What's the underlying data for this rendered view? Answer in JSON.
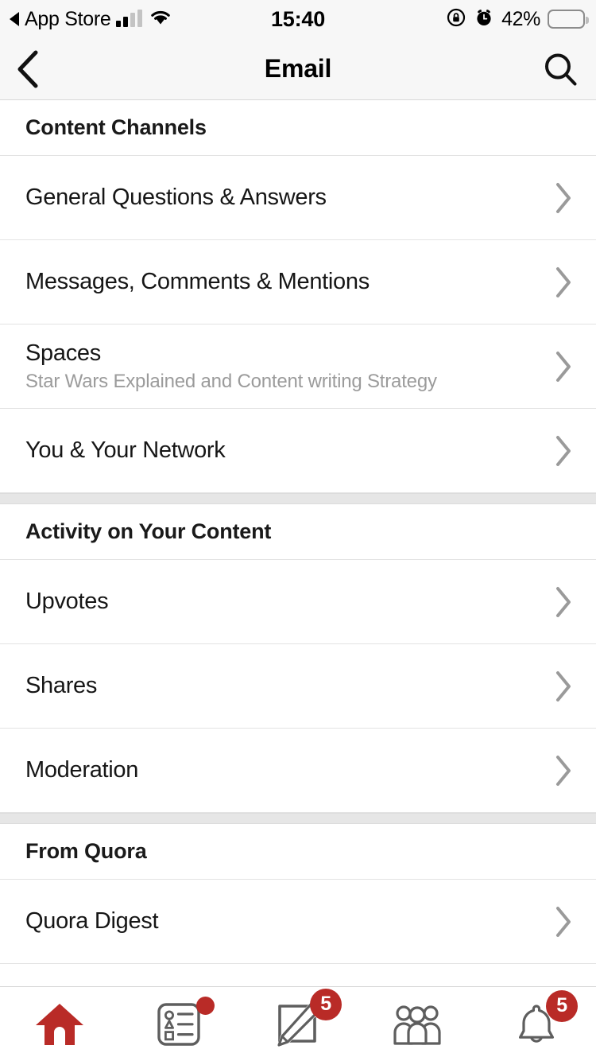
{
  "status_bar": {
    "back_app_label": "App Store",
    "back_arrow_icon": "triangle-left-icon",
    "signal_icon": "cellular-signal-icon",
    "wifi_icon": "wifi-icon",
    "time": "15:40",
    "rotation_lock_icon": "rotation-lock-icon",
    "alarm_icon": "alarm-clock-icon",
    "battery_percent": "42%",
    "battery_icon": "battery-icon",
    "battery_fill_color": "#ffcc00",
    "battery_level": 42
  },
  "nav_bar": {
    "back_icon": "chevron-left-icon",
    "title": "Email",
    "search_icon": "search-icon"
  },
  "sections": [
    {
      "header": "Content Channels",
      "rows": [
        {
          "title": "General Questions & Answers",
          "subtitle": "",
          "chevron_icon": "chevron-right-icon"
        },
        {
          "title": "Messages, Comments & Mentions",
          "subtitle": "",
          "chevron_icon": "chevron-right-icon"
        },
        {
          "title": "Spaces",
          "subtitle": "Star Wars Explained and Content writing Strategy",
          "chevron_icon": "chevron-right-icon"
        },
        {
          "title": "You & Your Network",
          "subtitle": "",
          "chevron_icon": "chevron-right-icon"
        }
      ]
    },
    {
      "header": "Activity on Your Content",
      "rows": [
        {
          "title": "Upvotes",
          "subtitle": "",
          "chevron_icon": "chevron-right-icon"
        },
        {
          "title": "Shares",
          "subtitle": "",
          "chevron_icon": "chevron-right-icon"
        },
        {
          "title": "Moderation",
          "subtitle": "",
          "chevron_icon": "chevron-right-icon"
        }
      ]
    },
    {
      "header": "From Quora",
      "rows": [
        {
          "title": "Quora Digest",
          "subtitle": "",
          "chevron_icon": "chevron-right-icon"
        }
      ]
    }
  ],
  "tab_bar": {
    "accent_color": "#b92b27",
    "inactive_color": "#5e5e5e",
    "tabs": [
      {
        "name": "home",
        "icon": "home-icon",
        "active": true,
        "badge": ""
      },
      {
        "name": "feed",
        "icon": "feed-list-icon",
        "active": false,
        "badge": "dot"
      },
      {
        "name": "answer",
        "icon": "compose-pencil-icon",
        "active": false,
        "badge": "5"
      },
      {
        "name": "spaces",
        "icon": "people-group-icon",
        "active": false,
        "badge": ""
      },
      {
        "name": "notifications",
        "icon": "bell-icon",
        "active": false,
        "badge": "5"
      }
    ]
  }
}
